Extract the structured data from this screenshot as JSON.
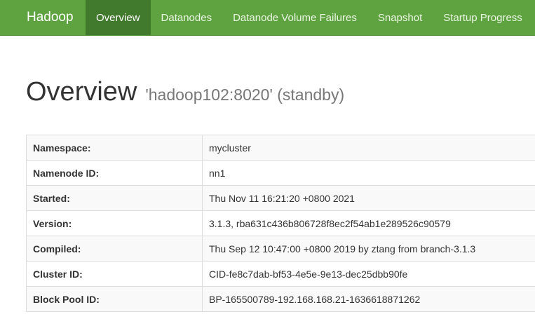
{
  "navbar": {
    "brand": "Hadoop",
    "items": [
      {
        "label": "Overview",
        "active": true
      },
      {
        "label": "Datanodes",
        "active": false
      },
      {
        "label": "Datanode Volume Failures",
        "active": false
      },
      {
        "label": "Snapshot",
        "active": false
      },
      {
        "label": "Startup Progress",
        "active": false
      }
    ]
  },
  "header": {
    "title": "Overview",
    "subtitle": "'hadoop102:8020' (standby)"
  },
  "overview_table": [
    {
      "key": "Namespace:",
      "value": "mycluster"
    },
    {
      "key": "Namenode ID:",
      "value": "nn1"
    },
    {
      "key": "Started:",
      "value": "Thu Nov 11 16:21:20 +0800 2021"
    },
    {
      "key": "Version:",
      "value": "3.1.3, rba631c436b806728f8ec2f54ab1e289526c90579"
    },
    {
      "key": "Compiled:",
      "value": "Thu Sep 12 10:47:00 +0800 2019 by ztang from branch-3.1.3"
    },
    {
      "key": "Cluster ID:",
      "value": "CID-fe8c7dab-bf53-4e5e-9e13-dec25dbb90fe"
    },
    {
      "key": "Block Pool ID:",
      "value": "BP-165500789-192.168.168.21-1636618871262"
    }
  ],
  "colors": {
    "navbar_bg": "#5fa341",
    "navbar_active_bg": "#417a2d"
  }
}
